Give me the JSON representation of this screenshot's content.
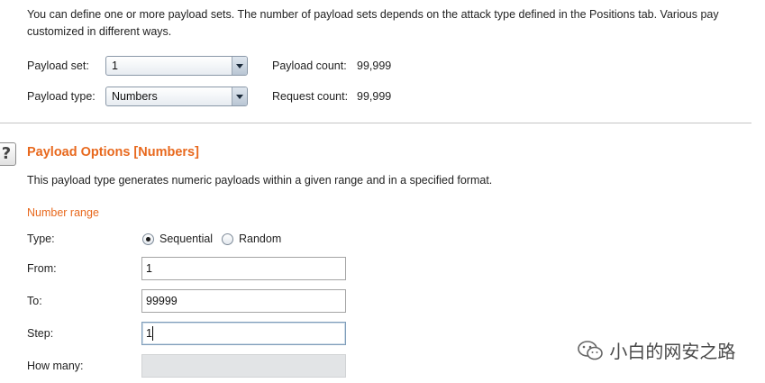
{
  "intro": {
    "line1": "You can define one or more payload sets. The number of payload sets depends on the attack type defined in the Positions tab. Various pay",
    "line2": "customized in different ways."
  },
  "payload_set": {
    "label": "Payload set:",
    "value": "1"
  },
  "payload_type": {
    "label": "Payload type:",
    "value": "Numbers"
  },
  "counts": {
    "payload_count_label": "Payload count:",
    "payload_count": "99,999",
    "request_count_label": "Request count:",
    "request_count": "99,999"
  },
  "options": {
    "help_glyph": "?",
    "title": "Payload Options [Numbers]",
    "description": "This payload type generates numeric payloads within a given range and in a specified format.",
    "number_range": "Number range",
    "type_label": "Type:",
    "type_options": [
      "Sequential",
      "Random"
    ],
    "type_selected": "Sequential",
    "from_label": "From:",
    "from_value": "1",
    "to_label": "To:",
    "to_value": "99999",
    "step_label": "Step:",
    "step_value": "1",
    "how_many_label": "How many:",
    "how_many_value": ""
  },
  "watermark": {
    "icon": "wechat-icon",
    "text": "小白的网安之路"
  },
  "colors": {
    "accent": "#e8691e",
    "text": "#222222",
    "divider": "#c5c5c5"
  }
}
